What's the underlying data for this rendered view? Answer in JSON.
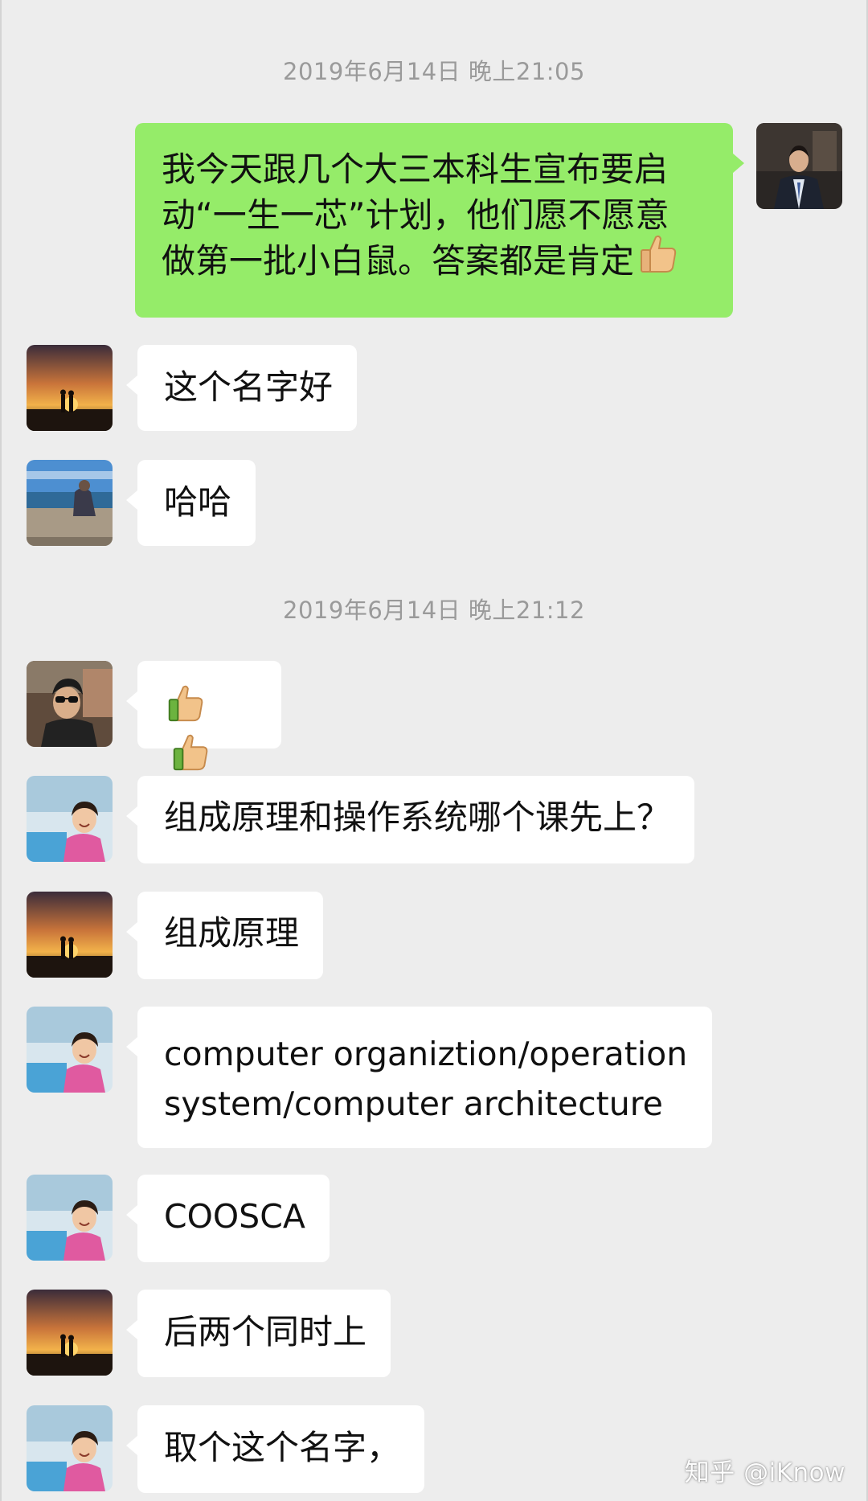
{
  "timestamps": [
    "2019年6月14日 晚上21:05",
    "2019年6月14日 晚上21:12"
  ],
  "messages": [
    {
      "lines": [
        "我今天跟几个大三本科生宣布要启",
        "动“一生一芯”计划，他们愿不愿意",
        "做第一批小白鼠。答案都是肯定"
      ],
      "emoji": "thumbs-up"
    },
    {
      "text": "这个名字好"
    },
    {
      "text": "哈哈"
    },
    {
      "emoji": "thumbs-up thumbs-up"
    },
    {
      "text": "组成原理和操作系统哪个课先上？"
    },
    {
      "text": "组成原理"
    },
    {
      "lines": [
        "computer organiztion/operation",
        "system/computer architecture"
      ]
    },
    {
      "text": "COOSCA"
    },
    {
      "text": "后两个同时上"
    },
    {
      "text": "取个这个名字，"
    }
  ],
  "watermark": "知乎 @iKnow",
  "colors": {
    "background": "#ededed",
    "outgoing_bubble": "#95ec69",
    "incoming_bubble": "#ffffff",
    "timestamp_text": "#9a9a9a"
  }
}
